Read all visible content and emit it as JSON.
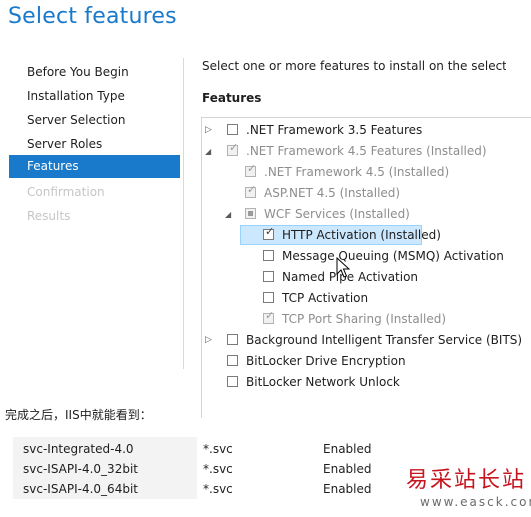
{
  "header": {
    "title": "Select features"
  },
  "nav": {
    "items": [
      {
        "label": "Before You Begin",
        "state": "normal"
      },
      {
        "label": "Installation Type",
        "state": "normal"
      },
      {
        "label": "Server Selection",
        "state": "normal"
      },
      {
        "label": "Server Roles",
        "state": "normal"
      },
      {
        "label": "Features",
        "state": "selected"
      },
      {
        "label": "Confirmation",
        "state": "disabled"
      },
      {
        "label": "Results",
        "state": "disabled"
      }
    ]
  },
  "main": {
    "intro": "Select one or more features to install on the selected serv",
    "heading": "Features",
    "tree": [
      {
        "label": ".NET Framework 3.5 Features",
        "checked": false,
        "greyed": false,
        "expander": "collapsed"
      },
      {
        "label": ".NET Framework 4.5 Features (Installed)",
        "checked": true,
        "greyed": true,
        "expander": "expanded"
      },
      {
        "label": ".NET Framework 4.5 (Installed)",
        "checked": true,
        "greyed": true,
        "expander": "none"
      },
      {
        "label": "ASP.NET 4.5 (Installed)",
        "checked": true,
        "greyed": true,
        "expander": "none"
      },
      {
        "label": "WCF Services (Installed)",
        "checked": "partial",
        "greyed": true,
        "expander": "expanded"
      },
      {
        "label": "HTTP Activation (Installed)",
        "checked": true,
        "greyed": false,
        "expander": "none",
        "selected": true
      },
      {
        "label": "Message Queuing (MSMQ) Activation",
        "checked": false,
        "greyed": false,
        "expander": "none"
      },
      {
        "label": "Named Pipe Activation",
        "checked": false,
        "greyed": false,
        "expander": "none"
      },
      {
        "label": "TCP Activation",
        "checked": false,
        "greyed": false,
        "expander": "none"
      },
      {
        "label": "TCP Port Sharing (Installed)",
        "checked": true,
        "greyed": true,
        "expander": "none"
      },
      {
        "label": "Background Intelligent Transfer Service (BITS)",
        "checked": false,
        "greyed": false,
        "expander": "collapsed"
      },
      {
        "label": "BitLocker Drive Encryption",
        "checked": false,
        "greyed": false,
        "expander": "none"
      },
      {
        "label": "BitLocker Network Unlock",
        "checked": false,
        "greyed": false,
        "expander": "none"
      }
    ]
  },
  "caption": "完成之后，IIS中就能看到：",
  "handlers": {
    "rows": [
      {
        "name": "svc-Integrated-4.0",
        "path": "*.svc",
        "state": "Enabled"
      },
      {
        "name": "svc-ISAPI-4.0_32bit",
        "path": "*.svc",
        "state": "Enabled"
      },
      {
        "name": "svc-ISAPI-4.0_64bit",
        "path": "*.svc",
        "state": "Enabled"
      }
    ]
  },
  "watermark": {
    "text": "易采站长站",
    "url": "www.easck.com"
  },
  "colors": {
    "accent": "#1979ca",
    "selection": "#cce8ff",
    "watermark": "#c7151f"
  }
}
